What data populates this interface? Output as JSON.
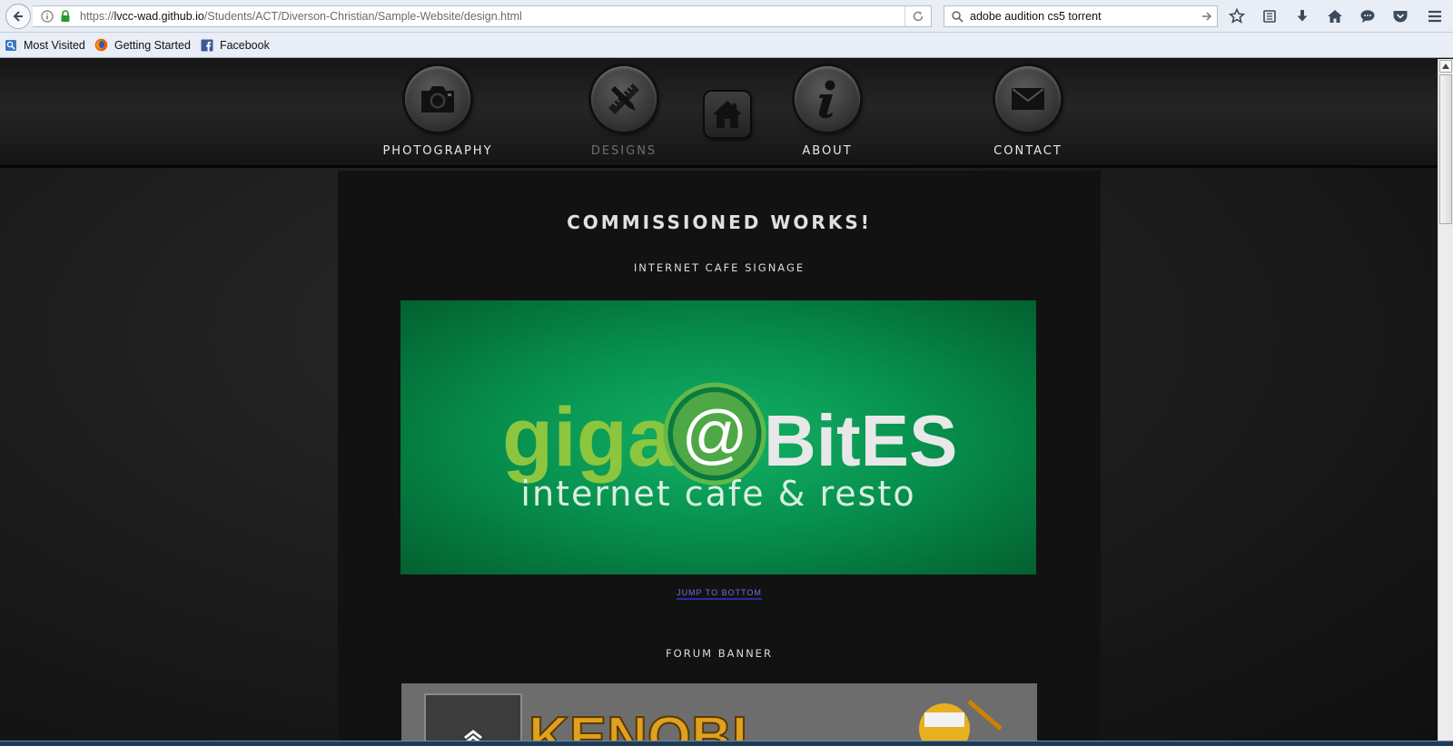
{
  "browser": {
    "url_host": "lvcc-wad.github.io",
    "url_prefix": "https://",
    "url_path": "/Students/ACT/Diverson-Christian/Sample-Website/design.html",
    "search_value": "adobe audition cs5 torrent",
    "bookmarks": [
      "Most Visited",
      "Getting Started",
      "Facebook"
    ]
  },
  "nav": {
    "items": [
      "Photography",
      "Designs",
      "About",
      "Contact"
    ]
  },
  "main": {
    "title": "Commissioned Works!",
    "sections": [
      {
        "title": "Internet Cafe Signage"
      },
      {
        "title": "Forum Banner"
      }
    ],
    "jump_link": "jump to bottom"
  },
  "signage": {
    "word_left": "giga",
    "at": "@",
    "word_right": "BitES",
    "tagline": "internet cafe & resto"
  },
  "banner": {
    "text": "KENOBI"
  },
  "colors": {
    "signage_green": "#07924f",
    "lime": "#8cc63f",
    "link_blue": "#6f6fd8"
  }
}
